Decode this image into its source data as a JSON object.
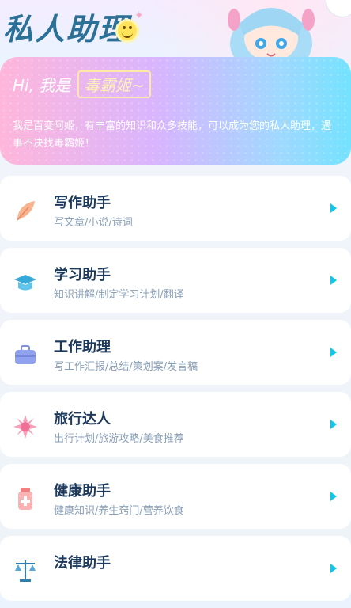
{
  "header": {
    "title": "私人助理",
    "emoji_icon": "smile-icon"
  },
  "banner": {
    "greeting": "Hi, 我是",
    "name": "毒霸姬~",
    "intro": "我是百变阿姬，有丰富的知识和众多技能，可以成为您的私人助理，遇事不决找毒霸姬！"
  },
  "items": [
    {
      "title": "写作助手",
      "sub": "写文章/小说/诗词",
      "icon": "feather-icon"
    },
    {
      "title": "学习助手",
      "sub": "知识讲解/制定学习计划/翻译",
      "icon": "graduation-cap-icon"
    },
    {
      "title": "工作助理",
      "sub": "写工作汇报/总结/策划案/发言稿",
      "icon": "briefcase-icon"
    },
    {
      "title": "旅行达人",
      "sub": "出行计划/旅游攻略/美食推荐",
      "icon": "flower-icon"
    },
    {
      "title": "健康助手",
      "sub": "健康知识/养生窍门/营养饮食",
      "icon": "medicine-bottle-icon"
    },
    {
      "title": "法律助手",
      "sub": "",
      "icon": "scales-icon"
    }
  ],
  "colors": {
    "accent": "#13c5e6",
    "title": "#2b7096"
  }
}
